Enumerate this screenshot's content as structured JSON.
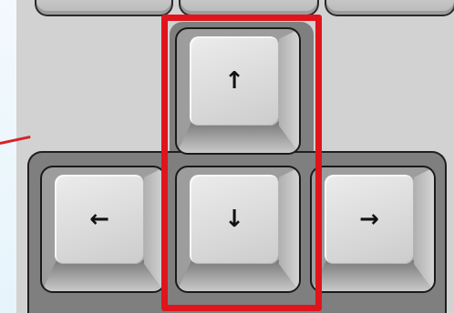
{
  "keys": {
    "up": {
      "glyph": "↑"
    },
    "left": {
      "glyph": "←"
    },
    "down": {
      "glyph": "↓"
    },
    "right": {
      "glyph": "→"
    }
  },
  "colors": {
    "highlight": "#e0141c",
    "background": "#eef7fd",
    "plate": "#d2d2d2"
  },
  "icons": {
    "up": "arrow-up-icon",
    "left": "arrow-left-icon",
    "down": "arrow-down-icon",
    "right": "arrow-right-icon"
  }
}
